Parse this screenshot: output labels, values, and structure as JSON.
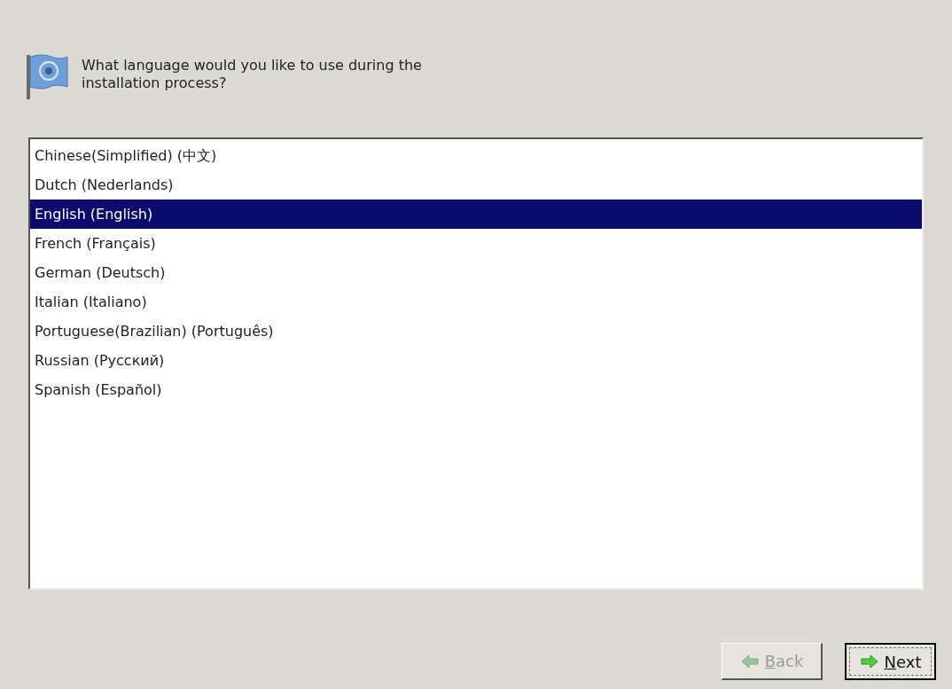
{
  "prompt": "What language would you like to use during the installation process?",
  "languages": [
    {
      "label": "Chinese(Simplified) (中文)",
      "selected": false
    },
    {
      "label": "Dutch (Nederlands)",
      "selected": false
    },
    {
      "label": "English (English)",
      "selected": true
    },
    {
      "label": "French (Français)",
      "selected": false
    },
    {
      "label": "German (Deutsch)",
      "selected": false
    },
    {
      "label": "Italian (Italiano)",
      "selected": false
    },
    {
      "label": "Portuguese(Brazilian) (Português)",
      "selected": false
    },
    {
      "label": "Russian (Русский)",
      "selected": false
    },
    {
      "label": "Spanish (Español)",
      "selected": false
    }
  ],
  "buttons": [
    {
      "kind": "back",
      "mnemonic": "B",
      "rest": "ack",
      "disabled": true
    },
    {
      "kind": "next",
      "mnemonic": "N",
      "rest": "ext",
      "disabled": false
    }
  ]
}
